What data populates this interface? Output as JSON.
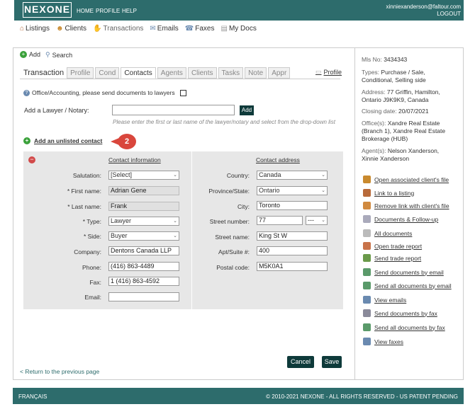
{
  "header": {
    "logo": "NEXONE",
    "nav": [
      "HOME",
      "PROFILE",
      "HELP"
    ],
    "user_email": "xinniexanderson@faltour.com",
    "logout": "LOGOUT"
  },
  "mainnav": {
    "listings": "Listings",
    "clients": "Clients",
    "transactions": "Transactions",
    "emails": "Emails",
    "faxes": "Faxes",
    "mydocs": "My Docs"
  },
  "toolbar": {
    "add": "Add",
    "search": "Search"
  },
  "tabs": {
    "title": "Transaction",
    "items": [
      "Profile",
      "Cond",
      "Contacts",
      "Agents",
      "Clients",
      "Tasks",
      "Note",
      "Appr"
    ],
    "active": "Contacts",
    "profile_link": "Profile"
  },
  "form": {
    "office_note": "Office/Accounting, please send documents to lawyers",
    "add_lawyer_label": "Add a Lawyer / Notary:",
    "add_button": "Add",
    "hint": "Please enter the first or last name of the lawyer/notary and select from the drop-down list",
    "unlisted_link": "Add an unlisted contact",
    "badge": "2",
    "contact_header": "Contact information",
    "address_header": "Contact address",
    "salutation_label": "Salutation:",
    "salutation": "[Select]",
    "first_label": "* First name:",
    "first": "Adrian Gene",
    "last_label": "* Last name:",
    "last": "Frank",
    "type_label": "* Type:",
    "type": "Lawyer",
    "side_label": "* Side:",
    "side": "Buyer",
    "company_label": "Company:",
    "company": "Dentons Canada LLP",
    "phone_label": "Phone:",
    "phone": "(416) 863-4489",
    "fax_label": "Fax:",
    "fax": "1 (416) 863-4592",
    "email_label": "Email:",
    "email": "",
    "country_label": "Country:",
    "country": "Canada",
    "province_label": "Province/State:",
    "province": "Ontario",
    "city_label": "City:",
    "city": "Toronto",
    "street_number_label": "Street number:",
    "street_number": "77",
    "street_suffix": "---",
    "street_name_label": "Street name:",
    "street_name": "King St W",
    "apt_label": "Apt/Suite #:",
    "apt": "400",
    "postal_label": "Postal code:",
    "postal": "M5K0A1"
  },
  "buttons": {
    "cancel": "Cancel",
    "save": "Save",
    "return": "< Return to the previous page"
  },
  "sidebar": {
    "mls_label": "Mls No:",
    "mls": "3434343",
    "types_label": "Types:",
    "types": "Purchase / Sale, Conditional, Selling side",
    "address_label": "Address:",
    "address": "77 Griffin, Hamilton, Ontario J9K9K9, Canada",
    "closing_label": "Closing date:",
    "closing": "20/07/2021",
    "offices_label": "Office(s):",
    "offices": "Xandre Real Estate (Branch 1), Xandre Real Estate Brokerage (HUB)",
    "agents_label": "Agent(s):",
    "agents": "Nelson Xanderson, Xinnie Xanderson",
    "links": [
      {
        "label": "Open associated client's file",
        "icon": "client-file-icon",
        "color": "#c98a2e"
      },
      {
        "label": "Link to a listing",
        "icon": "house-icon",
        "color": "#b86a3a"
      },
      {
        "label": "Remove link with client's file",
        "icon": "user-remove-icon",
        "color": "#d08a40"
      },
      {
        "label": "Documents & Follow-up",
        "icon": "document-icon",
        "color": "#aab"
      },
      {
        "label": "All documents",
        "icon": "documents-icon",
        "color": "#bbb"
      },
      {
        "label": "Open trade report",
        "icon": "report-icon",
        "color": "#c8734a"
      },
      {
        "label": "Send trade report",
        "icon": "send-report-icon",
        "color": "#6a9a4a"
      },
      {
        "label": "Send documents by email",
        "icon": "email-doc-icon",
        "color": "#5a9a6a"
      },
      {
        "label": "Send all documents by email",
        "icon": "email-all-icon",
        "color": "#5a9a6a"
      },
      {
        "label": "View emails",
        "icon": "view-email-icon",
        "color": "#6a8ab0"
      },
      {
        "label": "Send documents by fax",
        "icon": "fax-doc-icon",
        "color": "#8a8a9a"
      },
      {
        "label": "Send all documents by fax",
        "icon": "fax-all-icon",
        "color": "#5a9a6a"
      },
      {
        "label": "View faxes",
        "icon": "view-fax-icon",
        "color": "#6a8ab0"
      }
    ]
  },
  "footer": {
    "lang": "FRANÇAIS",
    "copyright": "© 2010-2021 NEXONE - ALL RIGHTS RESERVED - US PATENT PENDING"
  }
}
